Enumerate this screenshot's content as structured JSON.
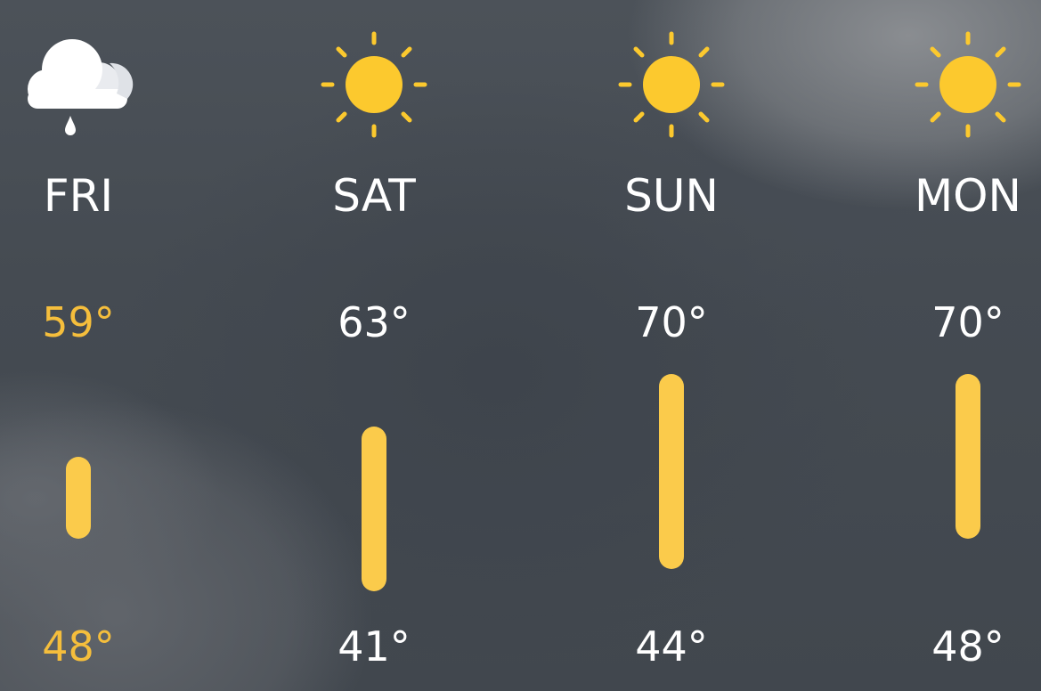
{
  "forecast": {
    "days": [
      {
        "day": "FRI",
        "high": "59°",
        "low": "48°",
        "icon": "rain-cloud-icon",
        "high_value": 59,
        "low_value": 48,
        "highlight": true
      },
      {
        "day": "SAT",
        "high": "63°",
        "low": "41°",
        "icon": "sun-icon",
        "high_value": 63,
        "low_value": 41,
        "highlight": false
      },
      {
        "day": "SUN",
        "high": "70°",
        "low": "44°",
        "icon": "sun-icon",
        "high_value": 70,
        "low_value": 44,
        "highlight": false
      },
      {
        "day": "MON",
        "high": "70°",
        "low": "48°",
        "icon": "sun-icon",
        "high_value": 70,
        "low_value": 48,
        "highlight": false
      }
    ],
    "range": {
      "min": 41,
      "max": 70
    }
  },
  "colors": {
    "accent_text": "#f5be3c",
    "bar": "#fbcb4b",
    "sun": "#fcc92e",
    "text": "#ffffff"
  }
}
